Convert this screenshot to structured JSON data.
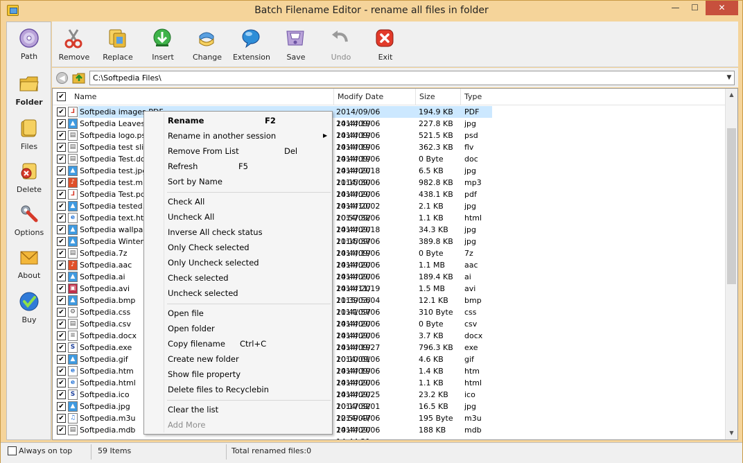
{
  "window": {
    "title": "Batch Filename Editor - rename all files in folder",
    "min_glyph": "—",
    "max_glyph": "☐",
    "close_glyph": "✕",
    "colors": {
      "frame": "#f5d49a",
      "selection": "#cce8ff",
      "close": "#c7503d"
    }
  },
  "sidebar": {
    "items": [
      {
        "label": "Path",
        "icon": "disc-icon"
      },
      {
        "label": "Folder",
        "icon": "folder-icon",
        "active": true
      },
      {
        "label": "Files",
        "icon": "files-icon"
      },
      {
        "label": "Delete",
        "icon": "delete-icon"
      },
      {
        "label": "Options",
        "icon": "wrench-icon"
      },
      {
        "label": "About",
        "icon": "envelope-icon"
      },
      {
        "label": "Buy",
        "icon": "checkmark-icon"
      }
    ]
  },
  "toolbar": {
    "items": [
      {
        "label": "Remove",
        "icon": "scissors-icon"
      },
      {
        "label": "Replace",
        "icon": "copy-icon"
      },
      {
        "label": "Insert",
        "icon": "insert-arrow-icon"
      },
      {
        "label": "Change",
        "icon": "change-icon"
      },
      {
        "label": "Extension",
        "icon": "extension-bubble-icon"
      },
      {
        "label": "Save",
        "icon": "save-icon"
      },
      {
        "label": "Undo",
        "icon": "undo-icon",
        "disabled": true
      },
      {
        "label": "Exit",
        "icon": "exit-icon"
      }
    ]
  },
  "pathbar": {
    "path": "C:\\Softpedia Files\\",
    "back_glyph": "◀",
    "dropdown_glyph": "▼"
  },
  "list": {
    "columns": {
      "name": "Name",
      "date": "Modify Date",
      "size": "Size",
      "type": "Type"
    },
    "check_glyph": "✔",
    "rows": [
      {
        "name": "Softpedia images.PDF",
        "date": "2014/09/06 14:44:19",
        "size": "194.9 KB",
        "type": "PDF",
        "icon": "pdf-icon"
      },
      {
        "name": "Softpedia Leaves.jpg",
        "date": "2014/09/06 14:44:19",
        "size": "227.8 KB",
        "type": "jpg",
        "icon": "image-icon"
      },
      {
        "name": "Softpedia logo.psd",
        "date": "2014/09/06 14:44:19",
        "size": "521.5 KB",
        "type": "psd",
        "icon": "generic-file-icon"
      },
      {
        "name": "Softpedia test slide.flv",
        "date": "2014/09/06 14:44:19",
        "size": "362.3 KB",
        "type": "flv",
        "icon": "generic-file-icon"
      },
      {
        "name": "Softpedia Test.doc",
        "date": "2014/09/06 14:44:20",
        "size": "0 Byte",
        "type": "doc",
        "icon": "generic-file-icon"
      },
      {
        "name": "Softpedia test.jpg",
        "date": "2014/09/18 11:15:30",
        "size": "6.5 KB",
        "type": "jpg",
        "icon": "image-icon"
      },
      {
        "name": "Softpedia test.mp3",
        "date": "2014/09/06 14:44:20",
        "size": "982.8 KB",
        "type": "mp3",
        "icon": "audio-icon"
      },
      {
        "name": "Softpedia Test.pdf",
        "date": "2014/09/06 14:44:20",
        "size": "438.1 KB",
        "type": "pdf",
        "icon": "pdf-icon"
      },
      {
        "name": "Softpedia tested.jpg",
        "date": "2014/10/02 10:57:32",
        "size": "2.1 KB",
        "type": "jpg",
        "icon": "image-icon"
      },
      {
        "name": "Softpedia text.html",
        "date": "2014/09/06 14:44:20",
        "size": "1.1 KB",
        "type": "html",
        "icon": "web-icon"
      },
      {
        "name": "Softpedia wallpaper.jpg",
        "date": "2014/09/18 11:15:37",
        "size": "34.3 KB",
        "type": "jpg",
        "icon": "image-icon"
      },
      {
        "name": "Softpedia Winter.jpg",
        "date": "2014/09/06 14:44:19",
        "size": "389.8 KB",
        "type": "jpg",
        "icon": "image-icon"
      },
      {
        "name": "Softpedia.7z",
        "date": "2014/09/06 14:44:20",
        "size": "0 Byte",
        "type": "7z",
        "icon": "generic-file-icon"
      },
      {
        "name": "Softpedia.aac",
        "date": "2014/09/06 14:44:20",
        "size": "1.1 MB",
        "type": "aac",
        "icon": "audio-icon"
      },
      {
        "name": "Softpedia.ai",
        "date": "2014/09/06 14:44:20",
        "size": "189.4 KB",
        "type": "ai",
        "icon": "image-icon"
      },
      {
        "name": "Softpedia.avi",
        "date": "2014/11/19 11:39:56",
        "size": "1.5 MB",
        "type": "avi",
        "icon": "video-icon"
      },
      {
        "name": "Softpedia.bmp",
        "date": "2015/03/04 11:41:57",
        "size": "12.1 KB",
        "type": "bmp",
        "icon": "image-icon"
      },
      {
        "name": "Softpedia.css",
        "date": "2014/09/06 14:44:20",
        "size": "310 Byte",
        "type": "css",
        "icon": "gear-file-icon"
      },
      {
        "name": "Softpedia.csv",
        "date": "2014/09/06 14:44:20",
        "size": "0 Byte",
        "type": "csv",
        "icon": "generic-file-icon"
      },
      {
        "name": "Softpedia.docx",
        "date": "2014/09/06 14:44:19",
        "size": "3.7 KB",
        "type": "docx",
        "icon": "document-icon"
      },
      {
        "name": "Softpedia.exe",
        "date": "2014/09/27 10:10:01",
        "size": "796.3 KB",
        "type": "exe",
        "icon": "softpedia-s-icon"
      },
      {
        "name": "Softpedia.gif",
        "date": "2014/09/06 14:44:19",
        "size": "4.6 KB",
        "type": "gif",
        "icon": "image-icon"
      },
      {
        "name": "Softpedia.htm",
        "date": "2014/09/06 14:44:20",
        "size": "1.4 KB",
        "type": "htm",
        "icon": "web-icon"
      },
      {
        "name": "Softpedia.html",
        "date": "2014/09/06 14:44:20",
        "size": "1.1 KB",
        "type": "html",
        "icon": "web-icon"
      },
      {
        "name": "Softpedia.ico",
        "date": "2014/09/25 10:17:32",
        "size": "23.2 KB",
        "type": "ico",
        "icon": "softpedia-s-icon"
      },
      {
        "name": "Softpedia.jpg",
        "date": "2014/09/01 12:59:47",
        "size": "16.5 KB",
        "type": "jpg",
        "icon": "image-icon"
      },
      {
        "name": "Softpedia.m3u",
        "date": "2014/09/06 14:44:20",
        "size": "195 Byte",
        "type": "m3u",
        "icon": "music-note-icon"
      },
      {
        "name": "Softpedia.mdb",
        "date": "2014/09/06 14:44:21",
        "size": "188 KB",
        "type": "mdb",
        "icon": "generic-file-icon"
      }
    ]
  },
  "context_menu": {
    "groups": [
      [
        {
          "label": "Rename",
          "shortcut": "F2",
          "bold": true
        },
        {
          "label": "Rename in another session",
          "submenu": true,
          "arrow": "▶"
        },
        {
          "label": "Remove From  List",
          "shortcut": "Del"
        },
        {
          "label": "Refresh",
          "shortcut": "F5"
        },
        {
          "label": "Sort by Name"
        }
      ],
      [
        {
          "label": "Check All"
        },
        {
          "label": "Uncheck All"
        },
        {
          "label": "Inverse All check status"
        },
        {
          "label": "Only Check selected"
        },
        {
          "label": "Only Uncheck selected"
        },
        {
          "label": "Check selected"
        },
        {
          "label": "Uncheck selected"
        }
      ],
      [
        {
          "label": "Open file"
        },
        {
          "label": "Open folder"
        },
        {
          "label": "Copy filename",
          "shortcut": "Ctrl+C"
        },
        {
          "label": "Create new folder"
        },
        {
          "label": "Show file property"
        },
        {
          "label": "Delete files to Recyclebin"
        }
      ],
      [
        {
          "label": "Clear the list"
        },
        {
          "label": "Add More",
          "disabled": true
        }
      ]
    ]
  },
  "statusbar": {
    "always_on_top": "Always on top",
    "items_count": "59 Items",
    "renamed": "Total renamed files:0"
  }
}
